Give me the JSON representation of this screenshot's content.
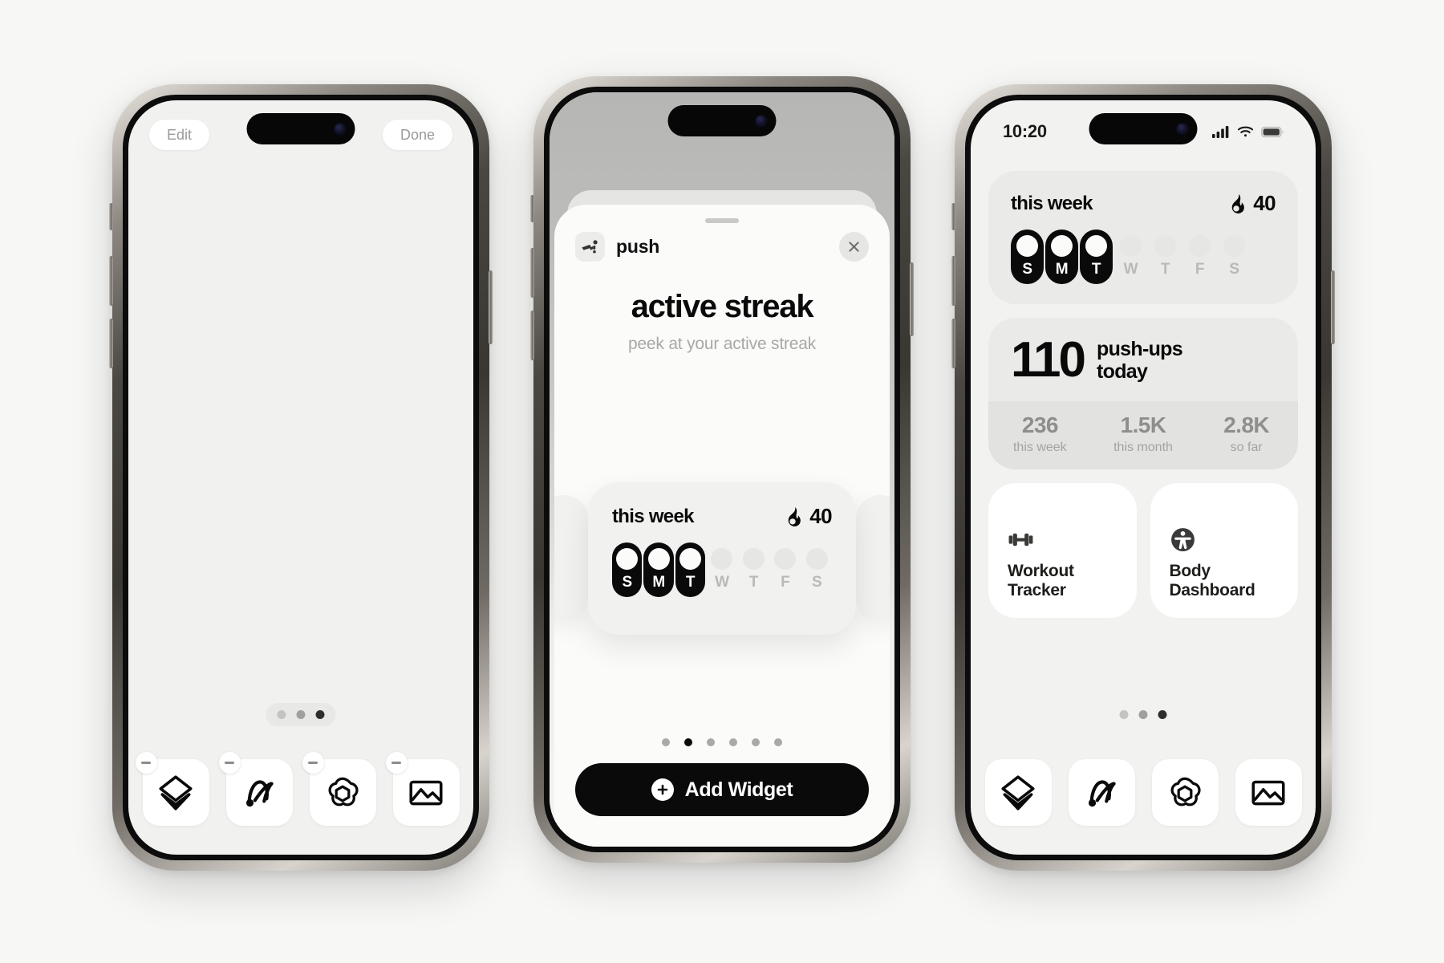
{
  "page": {
    "background_color": "#f7f7f6"
  },
  "phone1": {
    "name": "home-screen-edit-mode",
    "edit_button": "Edit",
    "done_button": "Done",
    "page_dots": {
      "count": 3,
      "active_index": 2
    },
    "dock": [
      {
        "name": "layers-app",
        "icon": "layers-icon",
        "remove_badge": "minus-icon"
      },
      {
        "name": "arc-browser-app",
        "icon": "arc-icon",
        "remove_badge": "minus-icon"
      },
      {
        "name": "chatgpt-app",
        "icon": "openai-icon",
        "remove_badge": "minus-icon"
      },
      {
        "name": "photos-app",
        "icon": "photo-icon",
        "remove_badge": "minus-icon"
      }
    ]
  },
  "phone2": {
    "name": "widget-picker-sheet",
    "app_chip": {
      "label": "push",
      "icon": "pushup-person-icon"
    },
    "close_icon": "close-icon",
    "widget_title": "active streak",
    "widget_subtitle": "peek at your active streak",
    "preview_widget": {
      "title": "this week",
      "flame_icon": "flame-icon",
      "streak_value": "40",
      "days": [
        {
          "letter": "S",
          "active": true
        },
        {
          "letter": "M",
          "active": true
        },
        {
          "letter": "T",
          "active": true
        },
        {
          "letter": "W",
          "active": false
        },
        {
          "letter": "T",
          "active": false
        },
        {
          "letter": "F",
          "active": false
        },
        {
          "letter": "S",
          "active": false
        }
      ]
    },
    "carousel_dots": {
      "count": 6,
      "active_index": 1
    },
    "add_widget_button": {
      "label": "Add Widget",
      "icon": "plus-circle-icon"
    }
  },
  "phone3": {
    "name": "home-screen-with-widgets",
    "status_bar": {
      "time": "10:20",
      "cellular_icon": "cellular-bars-icon",
      "wifi_icon": "wifi-icon",
      "battery_icon": "battery-icon"
    },
    "streak_widget": {
      "title": "this week",
      "flame_icon": "flame-icon",
      "streak_value": "40",
      "days": [
        {
          "letter": "S",
          "active": true
        },
        {
          "letter": "M",
          "active": true
        },
        {
          "letter": "T",
          "active": true
        },
        {
          "letter": "W",
          "active": false
        },
        {
          "letter": "T",
          "active": false
        },
        {
          "letter": "F",
          "active": false
        },
        {
          "letter": "S",
          "active": false
        }
      ]
    },
    "count_widget": {
      "value": "110",
      "unit_line1": "push-ups",
      "unit_line2": "today",
      "stats": [
        {
          "value": "236",
          "label": "this week"
        },
        {
          "value": "1.5K",
          "label": "this month"
        },
        {
          "value": "2.8K",
          "label": "so far"
        }
      ]
    },
    "shortcuts": [
      {
        "icon": "dumbbell-icon",
        "line1": "Workout",
        "line2": "Tracker"
      },
      {
        "icon": "accessibility-person-icon",
        "line1": "Body",
        "line2": "Dashboard"
      }
    ],
    "page_dots": {
      "count": 3,
      "active_index": 2
    },
    "dock": [
      {
        "name": "layers-app",
        "icon": "layers-icon"
      },
      {
        "name": "arc-browser-app",
        "icon": "arc-icon"
      },
      {
        "name": "chatgpt-app",
        "icon": "openai-icon"
      },
      {
        "name": "photos-app",
        "icon": "photo-icon"
      }
    ]
  }
}
